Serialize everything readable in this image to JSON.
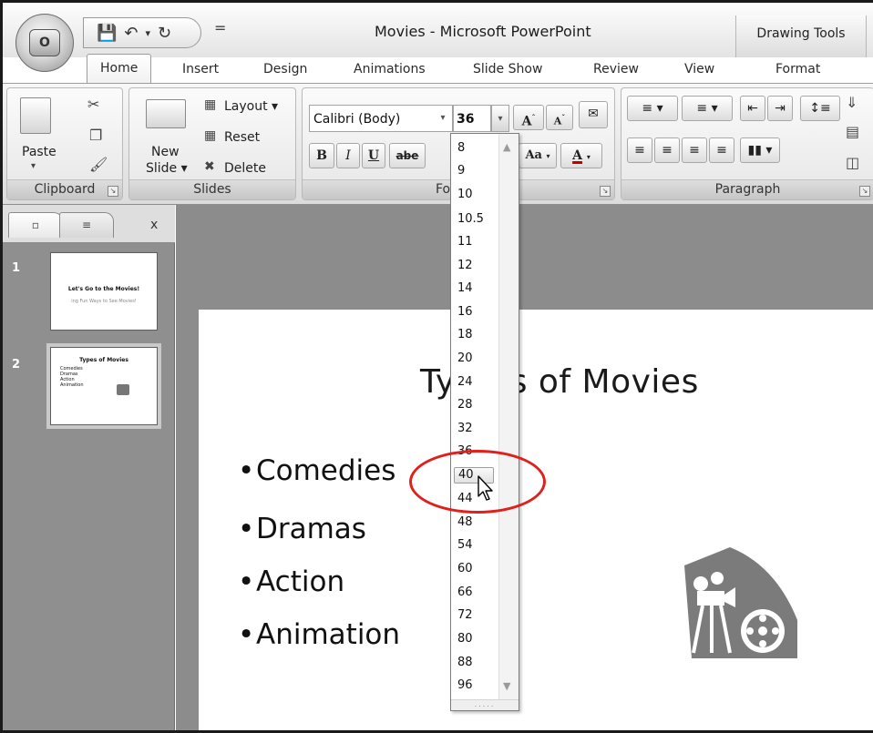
{
  "window": {
    "title": "Movies - Microsoft PowerPoint",
    "contextual_tab_group": "Drawing Tools",
    "qat_more": "="
  },
  "tabs": [
    "Home",
    "Insert",
    "Design",
    "Animations",
    "Slide Show",
    "Review",
    "View",
    "Format"
  ],
  "ribbon": {
    "clipboard": {
      "label": "Clipboard",
      "paste": "Paste"
    },
    "slides": {
      "label": "Slides",
      "new_slide_line1": "New",
      "new_slide_line2": "Slide",
      "layout": "Layout",
      "reset": "Reset",
      "delete": "Delete"
    },
    "font": {
      "label_visible": "Fo",
      "font_name": "Calibri (Body)",
      "font_size": "36",
      "bold": "B",
      "italic": "I",
      "underline": "U",
      "strike": "abe",
      "grow": "A",
      "shrink": "A",
      "change_case": "Aa",
      "font_color": "A"
    },
    "paragraph": {
      "label": "Paragraph"
    }
  },
  "sidebar": {
    "close": "x",
    "thumbs": [
      {
        "num": "1",
        "title": "Let's Go to the Movies!",
        "subtitle": "ing Fun Ways to See Movies!"
      },
      {
        "num": "2",
        "title": "Types of Movies",
        "bullets": [
          "Comedies",
          "Dramas",
          "Action",
          "Animation"
        ]
      }
    ]
  },
  "slide": {
    "title_left": "Ty",
    "title_right": "s of Movies",
    "bullets": [
      "Comedies",
      "Dramas",
      "Action",
      "Animation"
    ]
  },
  "font_size_dropdown": {
    "items": [
      "8",
      "9",
      "10",
      "10.5",
      "11",
      "12",
      "14",
      "16",
      "18",
      "20",
      "24",
      "28",
      "32",
      "36",
      "40",
      "44",
      "48",
      "54",
      "60",
      "66",
      "72",
      "80",
      "88",
      "96"
    ],
    "highlighted": "40",
    "grip": "....."
  },
  "colors": {
    "highlight_circle": "#e0201c"
  }
}
